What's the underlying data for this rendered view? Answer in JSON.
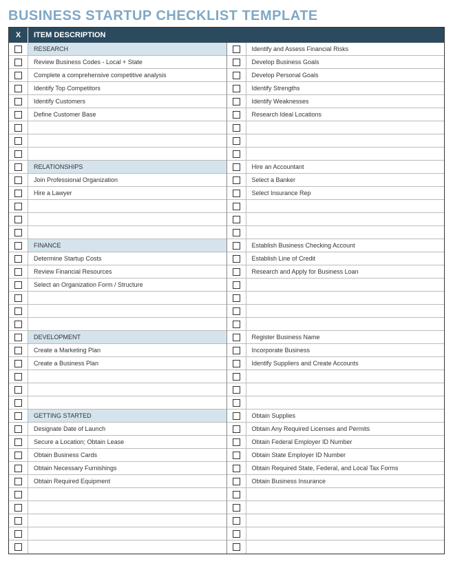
{
  "title": "BUSINESS STARTUP CHECKLIST TEMPLATE",
  "header": {
    "x": "X",
    "desc": "ITEM DESCRIPTION"
  },
  "left": [
    {
      "t": "RESEARCH",
      "h": true
    },
    {
      "t": "Review Business Codes - Local + State"
    },
    {
      "t": "Complete a comprehensive competitive analysis"
    },
    {
      "t": "Identify Top Competitors"
    },
    {
      "t": "Identify Customers"
    },
    {
      "t": "Define Customer Base"
    },
    {
      "t": ""
    },
    {
      "t": ""
    },
    {
      "t": ""
    },
    {
      "t": "RELATIONSHIPS",
      "h": true
    },
    {
      "t": "Join Professional Organization"
    },
    {
      "t": "Hire a Lawyer"
    },
    {
      "t": ""
    },
    {
      "t": ""
    },
    {
      "t": ""
    },
    {
      "t": "FINANCE",
      "h": true
    },
    {
      "t": "Determine Startup Costs"
    },
    {
      "t": "Review Financial Resources"
    },
    {
      "t": "Select an Organization Form / Structure"
    },
    {
      "t": ""
    },
    {
      "t": ""
    },
    {
      "t": ""
    },
    {
      "t": "DEVELOPMENT",
      "h": true
    },
    {
      "t": "Create a Marketing Plan"
    },
    {
      "t": "Create a Business Plan"
    },
    {
      "t": ""
    },
    {
      "t": ""
    },
    {
      "t": ""
    },
    {
      "t": "GETTING STARTED",
      "h": true
    },
    {
      "t": "Designate Date of Launch"
    },
    {
      "t": "Secure a Location;  Obtain Lease"
    },
    {
      "t": "Obtain Business Cards"
    },
    {
      "t": "Obtain Necessary Furnishings"
    },
    {
      "t": "Obtain Required Equipment"
    },
    {
      "t": ""
    },
    {
      "t": ""
    },
    {
      "t": ""
    },
    {
      "t": ""
    },
    {
      "t": ""
    }
  ],
  "right": [
    {
      "t": "Identify and Assess Financial Risks"
    },
    {
      "t": "Develop Business Goals"
    },
    {
      "t": "Develop Personal Goals"
    },
    {
      "t": "Identify Strengths"
    },
    {
      "t": "Identify Weaknesses"
    },
    {
      "t": "Research Ideal Locations"
    },
    {
      "t": ""
    },
    {
      "t": ""
    },
    {
      "t": ""
    },
    {
      "t": "Hire an Accountant"
    },
    {
      "t": "Select a Banker"
    },
    {
      "t": "Select Insurance Rep"
    },
    {
      "t": ""
    },
    {
      "t": ""
    },
    {
      "t": ""
    },
    {
      "t": "Establish Business Checking Account"
    },
    {
      "t": "Establish Line of Credit"
    },
    {
      "t": "Research and Apply for Business Loan"
    },
    {
      "t": ""
    },
    {
      "t": ""
    },
    {
      "t": ""
    },
    {
      "t": ""
    },
    {
      "t": "Register Business Name"
    },
    {
      "t": "Incorporate Business"
    },
    {
      "t": "Identify Suppliers and Create Accounts"
    },
    {
      "t": ""
    },
    {
      "t": ""
    },
    {
      "t": ""
    },
    {
      "t": "Obtain Supplies"
    },
    {
      "t": "Obtain Any Required Licenses and Permits"
    },
    {
      "t": "Obtain Federal Employer ID Number"
    },
    {
      "t": "Obtain State Employer ID Number"
    },
    {
      "t": "Obtain Required State, Federal, and Local Tax Forms"
    },
    {
      "t": "Obtain Business Insurance"
    },
    {
      "t": ""
    },
    {
      "t": ""
    },
    {
      "t": ""
    },
    {
      "t": ""
    },
    {
      "t": ""
    }
  ]
}
